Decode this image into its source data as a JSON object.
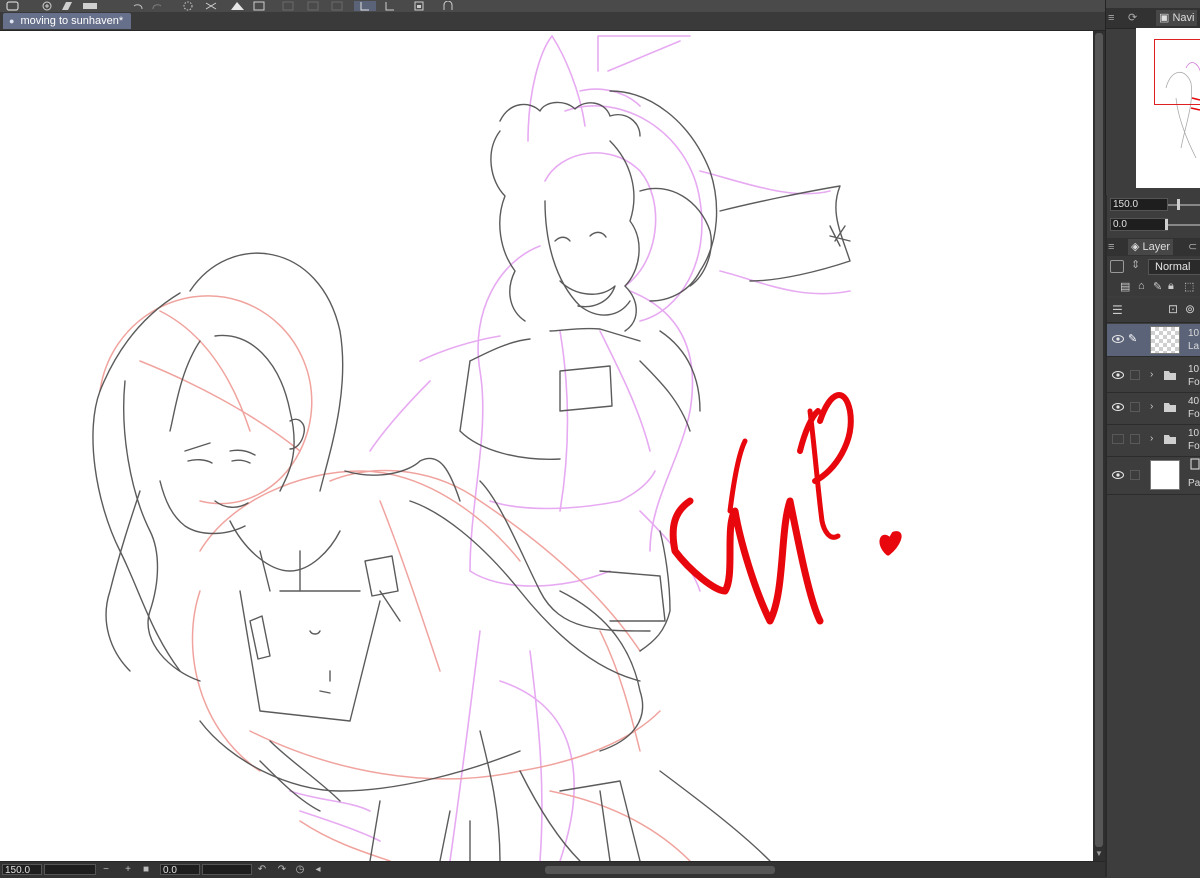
{
  "document": {
    "tab_title": "moving to sunhaven*"
  },
  "canvas": {
    "annotation_text": "WIP.",
    "annotation_color": "#e8070d"
  },
  "status_bar": {
    "zoom_value": "150.0",
    "rotation_value": "0.0"
  },
  "navigator": {
    "tab_label": "Navi",
    "zoom_value": "150.0",
    "rotation_value": "0.0"
  },
  "layer_panel": {
    "tab_label": "Layer",
    "blend_mode": "Normal",
    "layers": [
      {
        "line1": "10",
        "line2": "La",
        "kind": "raster",
        "visible": true,
        "active": true
      },
      {
        "line1": "10",
        "line2": "Fo",
        "kind": "folder",
        "visible": true,
        "active": false
      },
      {
        "line1": "40",
        "line2": "Fo",
        "kind": "folder",
        "visible": true,
        "active": false
      },
      {
        "line1": "10",
        "line2": "Fo",
        "kind": "folder",
        "visible": false,
        "active": false
      },
      {
        "line1": "",
        "line2": "Pa",
        "kind": "paper",
        "visible": true,
        "active": false
      }
    ]
  },
  "colors": {
    "panel_bg": "#3d3d3d",
    "active_layer": "#5b6379",
    "doc_tab": "#67708a"
  }
}
